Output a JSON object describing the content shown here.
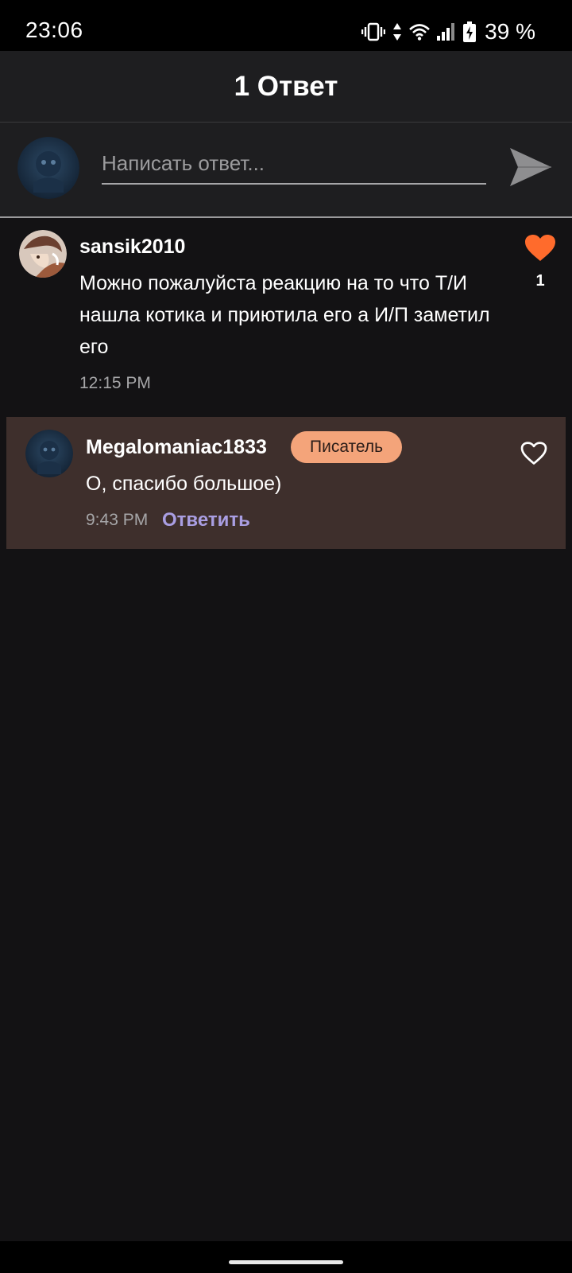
{
  "status_bar": {
    "time": "23:06",
    "battery": "39 %",
    "icons": [
      "vibrate-icon",
      "data-transfer-icon",
      "wifi-icon",
      "signal-icon",
      "battery-charging-icon"
    ]
  },
  "header": {
    "title": "1 Ответ"
  },
  "composer": {
    "placeholder": "Написать ответ...",
    "value": "",
    "send_icon": "send-icon"
  },
  "comment": {
    "username": "sansik2010",
    "text": "Можно пожалуйста реакцию на то что Т/И нашла котика и приютила его а И/П заметил его",
    "time": "12:15 PM",
    "like_count": "1",
    "liked": true,
    "like_color": "#ff6b2c"
  },
  "reply": {
    "username": "Megalomaniac1833",
    "badge": "Писатель",
    "text": "О, спасибо большое)",
    "time": "9:43 PM",
    "reply_label": "Ответить",
    "liked": false
  },
  "colors": {
    "background": "#131214",
    "header_bg": "#1e1e20",
    "reply_bg": "#3e2f2c",
    "badge_bg": "#f4a47a",
    "reply_link": "#a99ee2"
  }
}
